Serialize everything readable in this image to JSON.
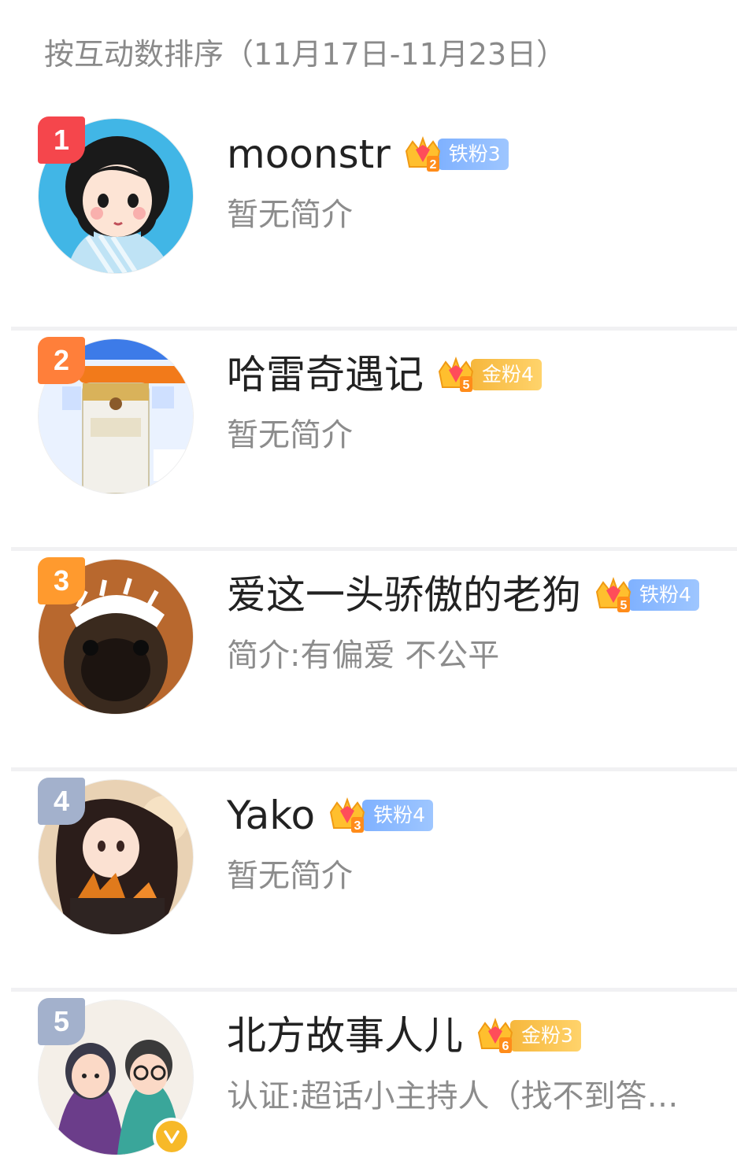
{
  "header": {
    "text": "按互动数排序（11月17日-11月23日）"
  },
  "colors": {
    "rank_1": "#f5464c",
    "rank_2": "#ff7f3a",
    "rank_3": "#ff9a2e",
    "rank_other": "#a3b1cc",
    "iron_badge": "#8fbaff",
    "gold_badge": "#f8c14a",
    "divider": "#f1f1f3"
  },
  "users": [
    {
      "rank": "1",
      "name": "moonstr",
      "crown_level": "2",
      "badge": "铁粉3",
      "badge_type": "iron",
      "intro": "暂无简介",
      "avatar_icon": "cartoon-girl-avatar"
    },
    {
      "rank": "2",
      "name": "哈雷奇遇记",
      "crown_level": "5",
      "badge": "金粉4",
      "badge_type": "gold",
      "intro": "暂无简介",
      "avatar_icon": "milk-powder-product-avatar"
    },
    {
      "rank": "3",
      "name": "爱这一头骄傲的老狗",
      "crown_level": "5",
      "badge": "铁粉4",
      "badge_type": "iron",
      "intro": "简介:有偏爱 不公平",
      "avatar_icon": "birthday-pug-avatar"
    },
    {
      "rank": "4",
      "name": "Yako",
      "crown_level": "3",
      "badge": "铁粉4",
      "badge_type": "iron",
      "intro": "暂无简介",
      "avatar_icon": "autumn-girl-avatar"
    },
    {
      "rank": "5",
      "name": "北方故事人儿",
      "crown_level": "6",
      "badge": "金粉3",
      "badge_type": "gold",
      "intro": "认证:超话小主持人（找不到答…",
      "avatar_icon": "cartoon-couple-avatar",
      "verified": true
    }
  ]
}
